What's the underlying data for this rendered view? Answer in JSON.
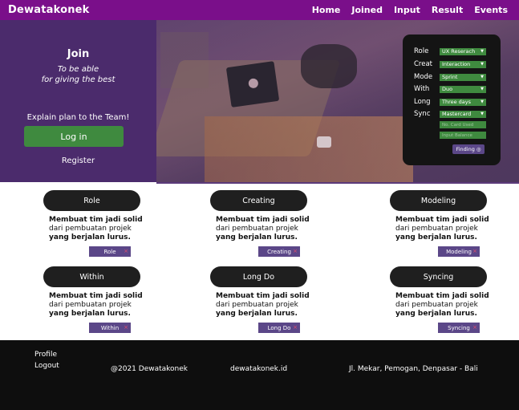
{
  "navbar": {
    "brand": "Dewatakonek",
    "links": [
      "Home",
      "Joined",
      "Input",
      "Result",
      "Events"
    ]
  },
  "hero": {
    "join_title": "Join",
    "join_sub_1": "To be able",
    "join_sub_2": "for giving the best",
    "explain": "Explain plan to the Team!",
    "login_label": "Log in",
    "register_label": "Register"
  },
  "filter": {
    "rows": [
      {
        "label": "Role",
        "value": "UX Reserach"
      },
      {
        "label": "Creat",
        "value": "Interaction"
      },
      {
        "label": "Mode",
        "value": "Sprint"
      },
      {
        "label": "With",
        "value": "Duo"
      },
      {
        "label": "Long",
        "value": "Three days"
      },
      {
        "label": "Sync",
        "value": "Mastercard"
      }
    ],
    "card_placeholder": "No. Card Used",
    "balance_placeholder": "Input Balance",
    "finding_label": "Finding"
  },
  "cards": [
    {
      "title": "Role",
      "desc1": "Membuat tim jadi solid",
      "desc2": "dari pembuatan projek",
      "desc3": "yang berjalan lurus.",
      "tag": "Role"
    },
    {
      "title": "Creating",
      "desc1": "Membuat tim jadi solid",
      "desc2": "dari pembuatan projek",
      "desc3": "yang berjalan lurus.",
      "tag": "Creating"
    },
    {
      "title": "Modeling",
      "desc1": "Membuat tim jadi solid",
      "desc2": "dari pembuatan projek",
      "desc3": "yang berjalan lurus.",
      "tag": "Modeling"
    },
    {
      "title": "Within",
      "desc1": "Membuat tim jadi solid",
      "desc2": "dari pembuatan projek",
      "desc3": "yang berjalan lurus.",
      "tag": "Within"
    },
    {
      "title": "Long Do",
      "desc1": "Membuat tim jadi solid",
      "desc2": "dari pembuatan projek",
      "desc3": "yang berjalan lurus.",
      "tag": "Long Do"
    },
    {
      "title": "Syncing",
      "desc1": "Membuat tim jadi solid",
      "desc2": "dari pembuatan projek",
      "desc3": "yang berjalan lurus.",
      "tag": "Syncing"
    }
  ],
  "footer": {
    "profile": "Profile",
    "logout": "Logout",
    "copyright": "@2021 Dewatakonek",
    "domain": "dewatakonek.id",
    "address": "Jl. Mekar, Pemogan, Denpasar - Bali"
  },
  "colors": {
    "nav": "#7a0f8a",
    "hero_left": "#4b2b6c",
    "green": "#3f8a3f",
    "tag": "#5b4788",
    "card_head": "#1f1f1f",
    "footer": "#0e0e0e"
  }
}
